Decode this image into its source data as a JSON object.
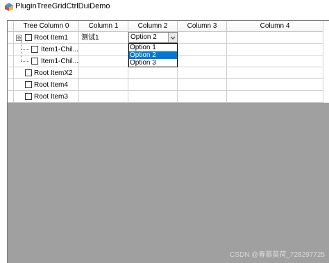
{
  "window": {
    "title": "PluginTreeGridCtrlDuiDemo",
    "icon": "app-icon"
  },
  "grid": {
    "columns": [
      "Tree Column 0",
      "Column 1",
      "Column 2",
      "Column 3",
      "Column 4"
    ],
    "rows": [
      {
        "label": "Root Item1",
        "level": 0,
        "expander": "⊖",
        "col1": "测试1"
      },
      {
        "label": "Item1-Chil...",
        "level": 1
      },
      {
        "label": "Item1-Chil...",
        "level": 1
      },
      {
        "label": "Root ItemX2",
        "level": 0
      },
      {
        "label": "Root Item4",
        "level": 0
      },
      {
        "label": "Root Item3",
        "level": 0
      }
    ]
  },
  "combo": {
    "value": "Option 2",
    "options": [
      "Option 1",
      "Option 2",
      "Option 3"
    ],
    "selected_index": 1
  },
  "watermark": "CSDN @春慕莫荷_728297725"
}
